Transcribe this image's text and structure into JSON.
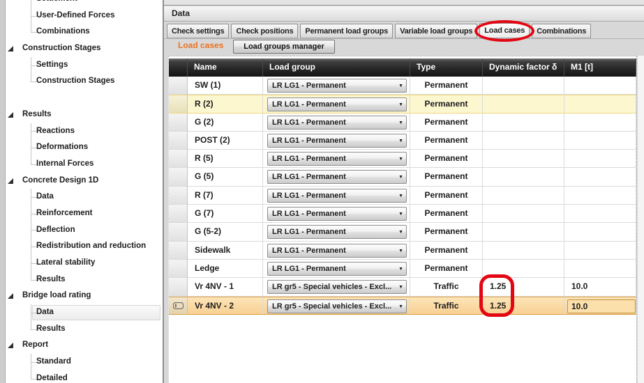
{
  "icons": {
    "dropdown_arrow": "▼",
    "expand_triangle": "expanded-tree-arrow"
  },
  "colors": {
    "annotation_red": "#e30613",
    "section_label_orange": "#ed7220",
    "row_highlight_yellow": "#fdf7d0",
    "row_highlight_orange": "#f8d093"
  },
  "sidebar": {
    "items": [
      {
        "label": "Settlement",
        "level": 1
      },
      {
        "label": "User-Defined Forces",
        "level": 1
      },
      {
        "label": "Combinations",
        "level": 1,
        "last": true
      },
      {
        "label": "Construction Stages",
        "level": 0
      },
      {
        "label": "Settings",
        "level": 1
      },
      {
        "label": "Construction Stages",
        "level": 1,
        "last": true
      },
      {
        "spacer": true
      },
      {
        "label": "Results",
        "level": 0
      },
      {
        "label": "Reactions",
        "level": 1
      },
      {
        "label": "Deformations",
        "level": 1
      },
      {
        "label": "Internal Forces",
        "level": 1,
        "last": true
      },
      {
        "label": "Concrete Design 1D",
        "level": 0
      },
      {
        "label": "Data",
        "level": 1
      },
      {
        "label": "Reinforcement",
        "level": 1
      },
      {
        "label": "Deflection",
        "level": 1
      },
      {
        "label": "Redistribution and reduction",
        "level": 1
      },
      {
        "label": "Lateral stability",
        "level": 1
      },
      {
        "label": "Results",
        "level": 1,
        "last": true
      },
      {
        "label": "Bridge load rating",
        "level": 0
      },
      {
        "label": "Data",
        "level": 1,
        "selected": true
      },
      {
        "label": "Results",
        "level": 1,
        "last": true
      },
      {
        "label": "Report",
        "level": 0
      },
      {
        "label": "Standard",
        "level": 1
      },
      {
        "label": "Detailed",
        "level": 1,
        "last": true
      }
    ]
  },
  "panel": {
    "title": "Data",
    "tabs": [
      {
        "label": "Check settings"
      },
      {
        "label": "Check positions"
      },
      {
        "label": "Permanent load groups"
      },
      {
        "label": "Variable load groups"
      },
      {
        "label": "Load cases",
        "active": true,
        "annotated": true
      },
      {
        "label": "Combinations"
      }
    ],
    "section_label": "Load cases",
    "manager_button": "Load groups manager",
    "table": {
      "columns": [
        "Name",
        "Load group",
        "Type",
        "Dynamic factor δ",
        "M1 [t]"
      ],
      "rows": [
        {
          "name": "SW (1)",
          "load_group": "LR LG1 - Permanent",
          "type": "Permanent",
          "dynamic_factor": "",
          "m1": ""
        },
        {
          "name": "R (2)",
          "load_group": "LR LG1 - Permanent",
          "type": "Permanent",
          "dynamic_factor": "",
          "m1": "",
          "highlight": "yellow"
        },
        {
          "name": "G (2)",
          "load_group": "LR LG1 - Permanent",
          "type": "Permanent",
          "dynamic_factor": "",
          "m1": ""
        },
        {
          "name": "POST (2)",
          "load_group": "LR LG1 - Permanent",
          "type": "Permanent",
          "dynamic_factor": "",
          "m1": ""
        },
        {
          "name": "R (5)",
          "load_group": "LR LG1 - Permanent",
          "type": "Permanent",
          "dynamic_factor": "",
          "m1": ""
        },
        {
          "name": "G (5)",
          "load_group": "LR LG1 - Permanent",
          "type": "Permanent",
          "dynamic_factor": "",
          "m1": ""
        },
        {
          "name": "R (7)",
          "load_group": "LR LG1 - Permanent",
          "type": "Permanent",
          "dynamic_factor": "",
          "m1": ""
        },
        {
          "name": "G (7)",
          "load_group": "LR LG1 - Permanent",
          "type": "Permanent",
          "dynamic_factor": "",
          "m1": ""
        },
        {
          "name": "G (5-2)",
          "load_group": "LR LG1 - Permanent",
          "type": "Permanent",
          "dynamic_factor": "",
          "m1": ""
        },
        {
          "name": "Sidewalk",
          "load_group": "LR LG1 - Permanent",
          "type": "Permanent",
          "dynamic_factor": "",
          "m1": ""
        },
        {
          "name": "Ledge",
          "load_group": "LR LG1 - Permanent",
          "type": "Permanent",
          "dynamic_factor": "",
          "m1": ""
        },
        {
          "name": "Vr 4NV - 1",
          "load_group": "LR gr5 - Special vehicles - Excl...",
          "type": "Traffic",
          "dynamic_factor": "1.25",
          "m1": "10.0"
        },
        {
          "name": "Vr 4NV - 2",
          "load_group": "LR gr5 - Special vehicles - Excl...",
          "type": "Traffic",
          "dynamic_factor": "1.25",
          "m1": "10.0",
          "highlight": "orange",
          "selected": true,
          "editing": true
        }
      ]
    }
  },
  "annotations": {
    "tab_circle_target": "Load cases",
    "value_box_rows": [
      11,
      12
    ],
    "value_box_values": [
      "1.25",
      "1.25"
    ]
  }
}
